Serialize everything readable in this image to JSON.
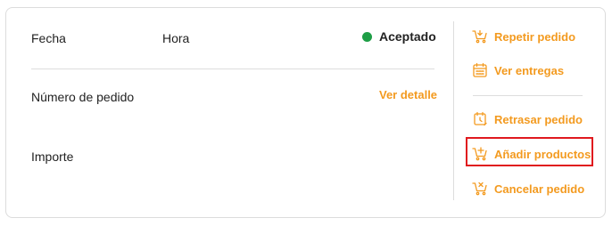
{
  "order": {
    "date_label": "Fecha",
    "time_label": "Hora",
    "status": "Aceptado",
    "order_number_label": "Número de pedido",
    "detail_link": "Ver detalle",
    "amount_label": "Importe"
  },
  "actions": {
    "repeat": "Repetir pedido",
    "deliveries": "Ver entregas",
    "delay": "Retrasar pedido",
    "add_products": "Añadir productos",
    "cancel": "Cancelar pedido"
  },
  "colors": {
    "accent": "#f39a1f",
    "status_ok": "#1e9e46",
    "highlight_border": "#e0191e"
  },
  "icons": {
    "repeat": "cart-repeat-icon",
    "deliveries": "calendar-icon",
    "delay": "delay-clock-icon",
    "add_products": "cart-plus-icon",
    "cancel": "cart-cancel-icon"
  }
}
